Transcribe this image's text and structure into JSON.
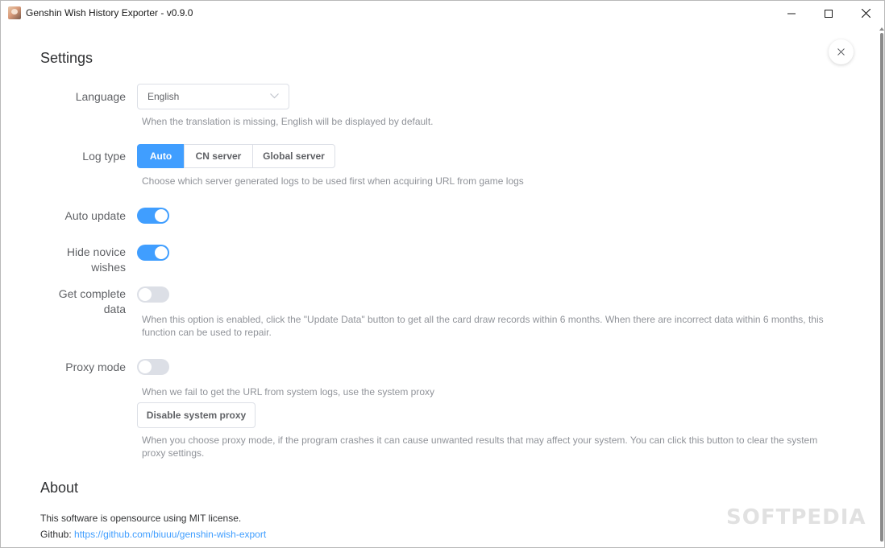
{
  "window": {
    "title": "Genshin Wish History Exporter - v0.9.0"
  },
  "settings": {
    "title": "Settings",
    "language": {
      "label": "Language",
      "value": "English",
      "hint": "When the translation is missing, English will be displayed by default."
    },
    "log_type": {
      "label": "Log type",
      "options": [
        "Auto",
        "CN server",
        "Global server"
      ],
      "selected": "Auto",
      "hint": "Choose which server generated logs to be used first when acquiring URL from game logs"
    },
    "auto_update": {
      "label": "Auto update",
      "enabled": true
    },
    "hide_novice": {
      "label_line1": "Hide novice",
      "label_line2": "wishes",
      "enabled": true
    },
    "complete_data": {
      "label_line1": "Get complete",
      "label_line2": "data",
      "enabled": false,
      "hint_line1": "When this option is enabled, click the \"Update Data\" button to get all the card draw records within 6 months. When there are incorrect data within 6 months, this",
      "hint_line2": "function can be used to repair."
    },
    "proxy_mode": {
      "label": "Proxy mode",
      "enabled": false,
      "hint": "When we fail to get the URL from system logs, use the system proxy",
      "button_label": "Disable system proxy",
      "button_hint_line1": "When you choose proxy mode, if the program crashes it can cause unwanted results that may affect your system. You can click this button to clear the system",
      "button_hint_line2": "proxy settings."
    }
  },
  "about": {
    "title": "About",
    "license_text": "This software is opensource using MIT license.",
    "github_label": "Github:",
    "github_url": "https://github.com/biuuu/genshin-wish-export"
  },
  "watermark": "SOFTPEDIA",
  "colors": {
    "accent": "#409eff",
    "switch_off": "#dcdfe6",
    "hint": "#909399"
  }
}
